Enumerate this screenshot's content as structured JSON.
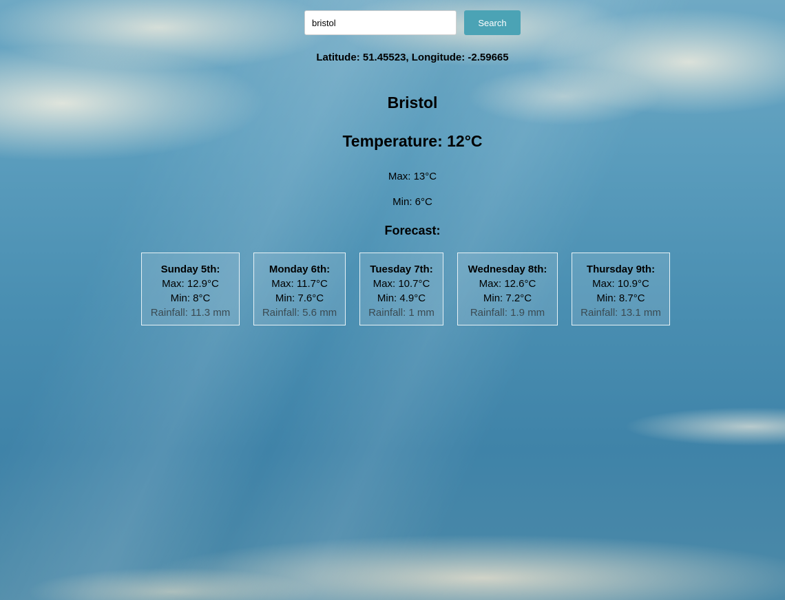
{
  "search": {
    "value": "bristol",
    "button_label": "Search"
  },
  "location": {
    "coords_text": "Latitude: 51.45523, Longitude: -2.59665",
    "city": "Bristol"
  },
  "current": {
    "temperature_text": "Temperature: 12°C",
    "max_text": "Max: 13°C",
    "min_text": "Min: 6°C"
  },
  "forecast": {
    "title": "Forecast:",
    "days": [
      {
        "day": "Sunday 5th:",
        "max": "Max: 12.9°C",
        "min": "Min: 8°C",
        "rain": "Rainfall: 11.3 mm"
      },
      {
        "day": "Monday 6th:",
        "max": "Max: 11.7°C",
        "min": "Min: 7.6°C",
        "rain": "Rainfall: 5.6 mm"
      },
      {
        "day": "Tuesday 7th:",
        "max": "Max: 10.7°C",
        "min": "Min: 4.9°C",
        "rain": "Rainfall: 1 mm"
      },
      {
        "day": "Wednesday 8th:",
        "max": "Max: 12.6°C",
        "min": "Min: 7.2°C",
        "rain": "Rainfall: 1.9 mm"
      },
      {
        "day": "Thursday 9th:",
        "max": "Max: 10.9°C",
        "min": "Min: 8.7°C",
        "rain": "Rainfall: 13.1 mm"
      }
    ]
  },
  "colors": {
    "button": "#4ba3b5",
    "sky": "#4a8fb2"
  }
}
